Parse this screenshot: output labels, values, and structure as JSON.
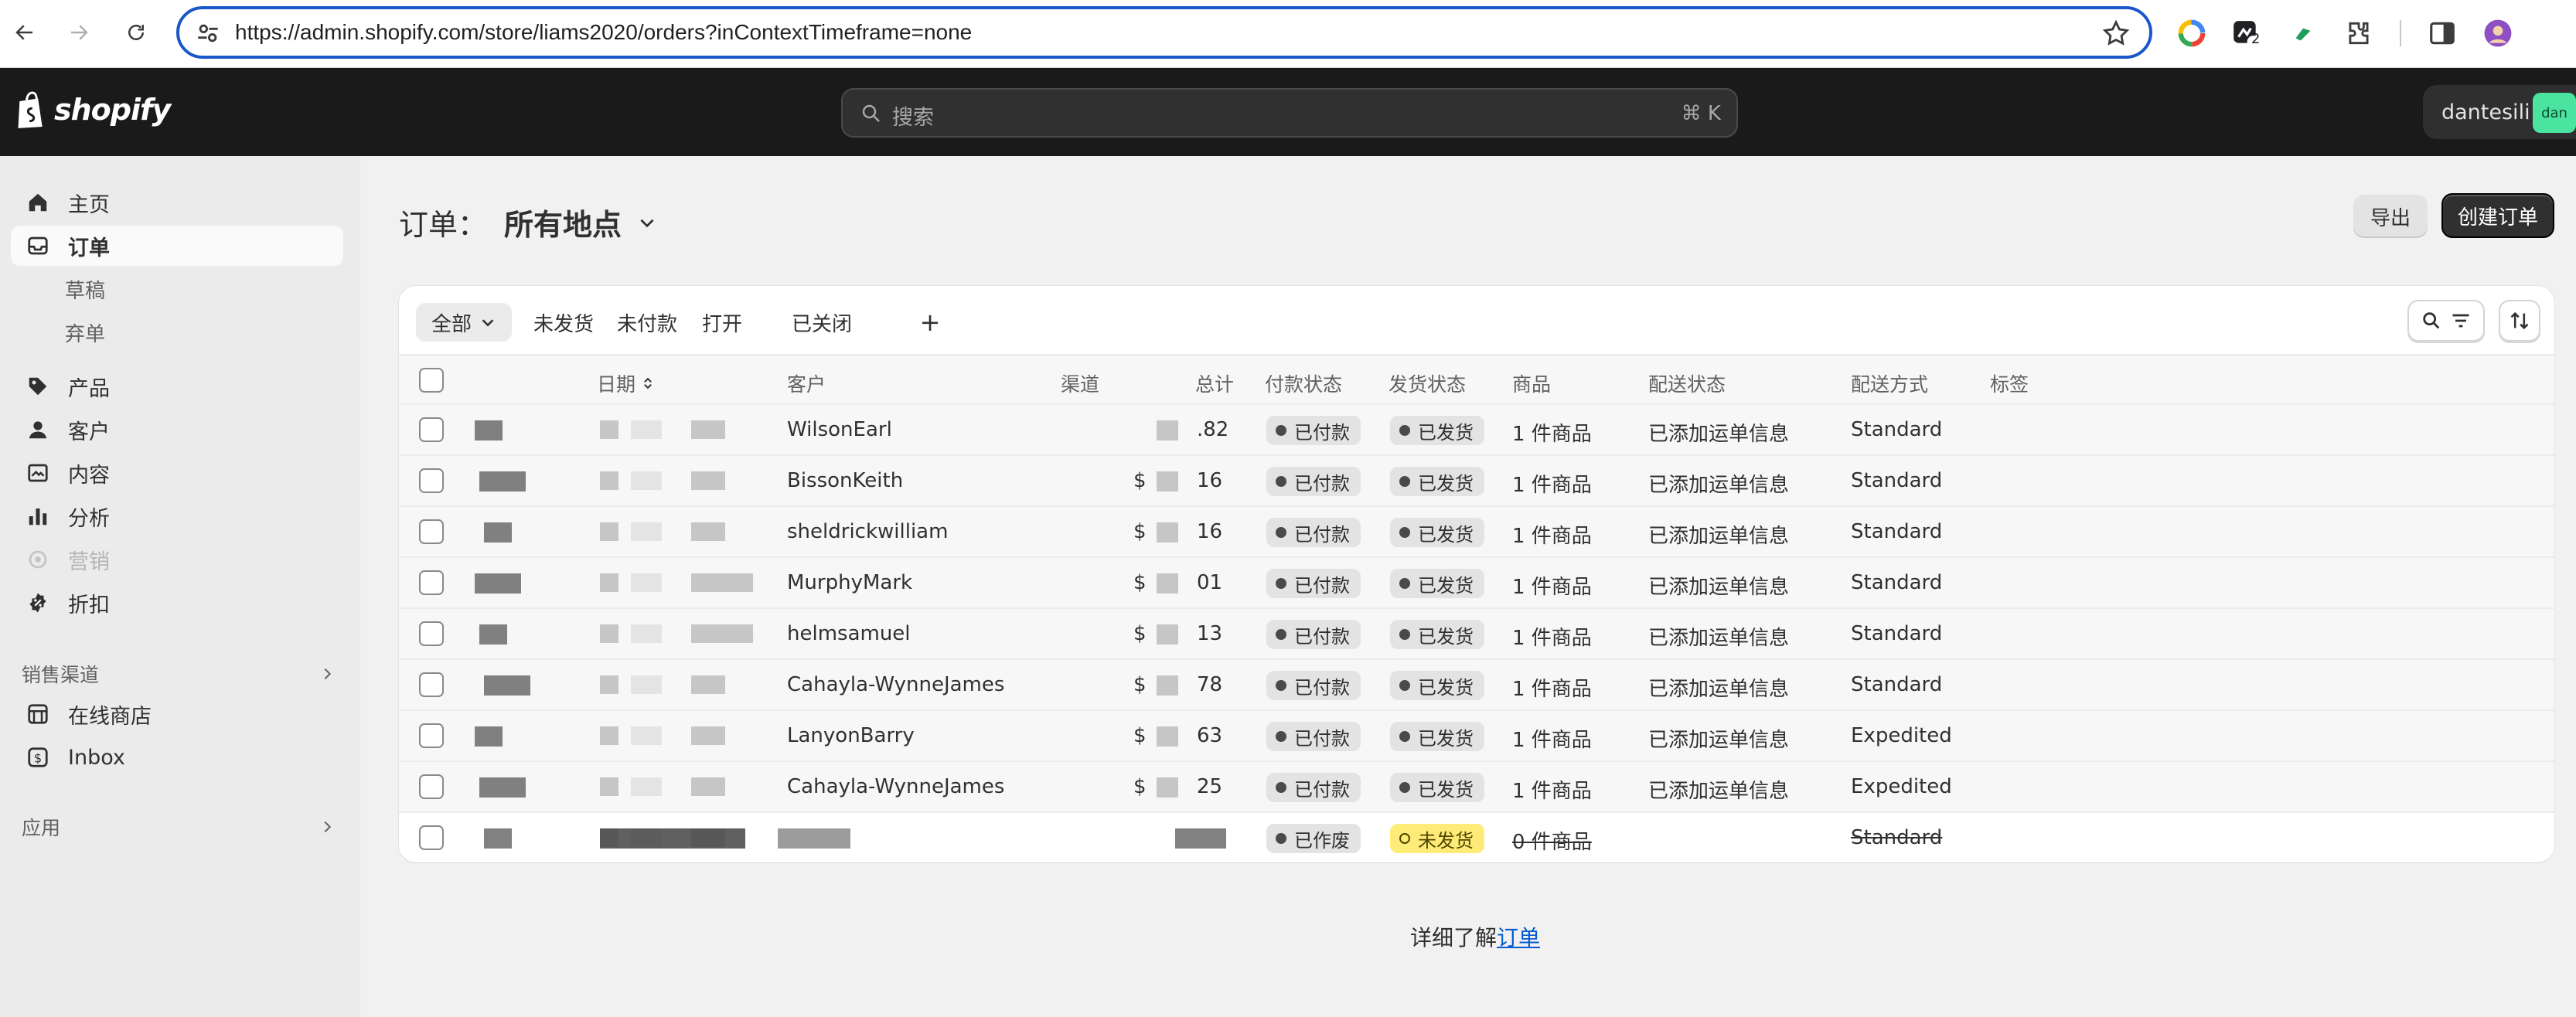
{
  "browser": {
    "url": "https://admin.shopify.com/store/liams2020/orders?inContextTimeframe=none",
    "ext_badge": "2"
  },
  "topbar": {
    "brand": "shopify",
    "search_placeholder": "搜索",
    "search_shortcut": "⌘ K",
    "user_name": "dantesili",
    "user_avatar": "dan"
  },
  "sidebar": {
    "items": [
      {
        "label": "主页",
        "icon": "home-icon"
      },
      {
        "label": "订单",
        "icon": "inbox-icon",
        "active": true
      },
      {
        "label": "草稿"
      },
      {
        "label": "弃单"
      },
      {
        "label": "产品",
        "icon": "tag-icon"
      },
      {
        "label": "客户",
        "icon": "person-icon"
      },
      {
        "label": "内容",
        "icon": "content-icon"
      },
      {
        "label": "分析",
        "icon": "chart-icon"
      },
      {
        "label": "营销",
        "icon": "target-icon",
        "disabled": true
      },
      {
        "label": "折扣",
        "icon": "discount-icon"
      }
    ],
    "sales_channels_label": "销售渠道",
    "online_store_label": "在线商店",
    "inbox_label": "Inbox",
    "apps_label": "应用"
  },
  "page": {
    "title": "订单：",
    "location": "所有地点",
    "export_label": "导出",
    "create_label": "创建订单"
  },
  "tabs": [
    "全部",
    "未发货",
    "未付款",
    "打开",
    "已关闭"
  ],
  "table": {
    "headers": {
      "date": "日期",
      "customer": "客户",
      "channel": "渠道",
      "total": "总计",
      "payment": "付款状态",
      "fulfillment": "发货状态",
      "items": "商品",
      "delivery_status": "配送状态",
      "delivery_method": "配送方式",
      "tags": "标签"
    },
    "rows": [
      {
        "customer": "WilsonEarl",
        "total": ".82",
        "payment": "已付款",
        "fulfillment": "已发货",
        "items": "1 件商品",
        "delivery_status": "已添加运单信息",
        "delivery_method": "Standard"
      },
      {
        "customer": "BissonKeith",
        "total": "16",
        "payment": "已付款",
        "fulfillment": "已发货",
        "items": "1 件商品",
        "delivery_status": "已添加运单信息",
        "delivery_method": "Standard"
      },
      {
        "customer": "sheldrickwilliam",
        "total": "16",
        "payment": "已付款",
        "fulfillment": "已发货",
        "items": "1 件商品",
        "delivery_status": "已添加运单信息",
        "delivery_method": "Standard"
      },
      {
        "customer": "MurphyMark",
        "total": "01",
        "payment": "已付款",
        "fulfillment": "已发货",
        "items": "1 件商品",
        "delivery_status": "已添加运单信息",
        "delivery_method": "Standard"
      },
      {
        "customer": "helmsamuel",
        "total": "13",
        "payment": "已付款",
        "fulfillment": "已发货",
        "items": "1 件商品",
        "delivery_status": "已添加运单信息",
        "delivery_method": "Standard"
      },
      {
        "customer": "Cahayla-WynneJames",
        "total": "78",
        "payment": "已付款",
        "fulfillment": "已发货",
        "items": "1 件商品",
        "delivery_status": "已添加运单信息",
        "delivery_method": "Standard"
      },
      {
        "customer": "LanyonBarry",
        "total": "63",
        "payment": "已付款",
        "fulfillment": "已发货",
        "items": "1 件商品",
        "delivery_status": "已添加运单信息",
        "delivery_method": "Expedited"
      },
      {
        "customer": "Cahayla-WynneJames",
        "total": "25",
        "payment": "已付款",
        "fulfillment": "已发货",
        "items": "1 件商品",
        "delivery_status": "已添加运单信息",
        "delivery_method": "Expedited"
      },
      {
        "customer": "",
        "total": "",
        "payment": "已作废",
        "fulfillment": "未发货",
        "items": "0 件商品",
        "delivery_status": "",
        "delivery_method": "Standard"
      }
    ]
  },
  "footer": {
    "text": "详细了解",
    "link": "订单"
  }
}
